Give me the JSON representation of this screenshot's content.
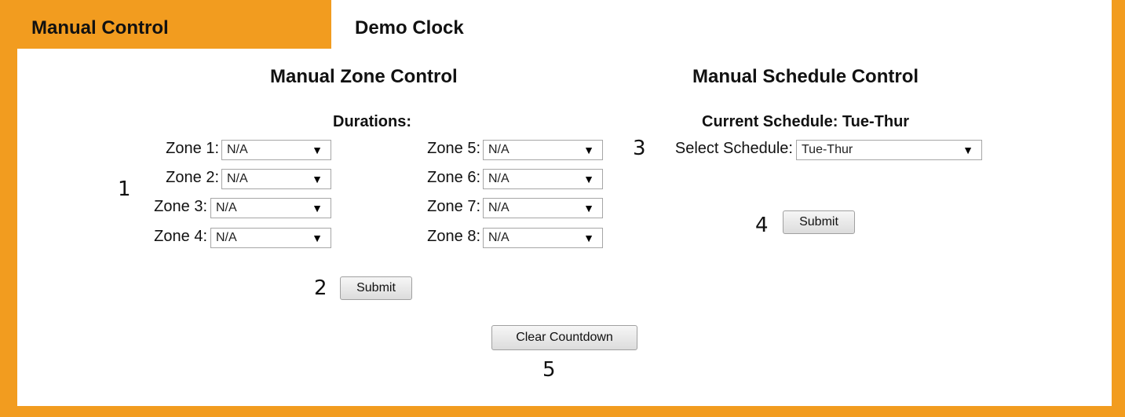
{
  "tabs": [
    {
      "label": "Manual Control"
    },
    {
      "label": "Demo Clock"
    }
  ],
  "zone_control": {
    "title": "Manual Zone Control",
    "durations_label": "Durations:",
    "zones": [
      {
        "label": "Zone 1:",
        "value": "N/A"
      },
      {
        "label": "Zone 2:",
        "value": "N/A"
      },
      {
        "label": "Zone 3:",
        "value": "N/A"
      },
      {
        "label": "Zone 4:",
        "value": "N/A"
      },
      {
        "label": "Zone 5:",
        "value": "N/A"
      },
      {
        "label": "Zone 6:",
        "value": "N/A"
      },
      {
        "label": "Zone 7:",
        "value": "N/A"
      },
      {
        "label": "Zone 8:",
        "value": "N/A"
      }
    ],
    "submit_label": "Submit"
  },
  "schedule_control": {
    "title": "Manual Schedule Control",
    "current_schedule": "Current Schedule: Tue-Thur",
    "select_label": "Select Schedule:",
    "select_value": "Tue-Thur",
    "submit_label": "Submit"
  },
  "clear_countdown_label": "Clear Countdown",
  "markers": [
    "1",
    "2",
    "3",
    "4",
    "5"
  ],
  "colors": {
    "accent": "#f29c1f"
  },
  "dropdown_arrow": "▼"
}
